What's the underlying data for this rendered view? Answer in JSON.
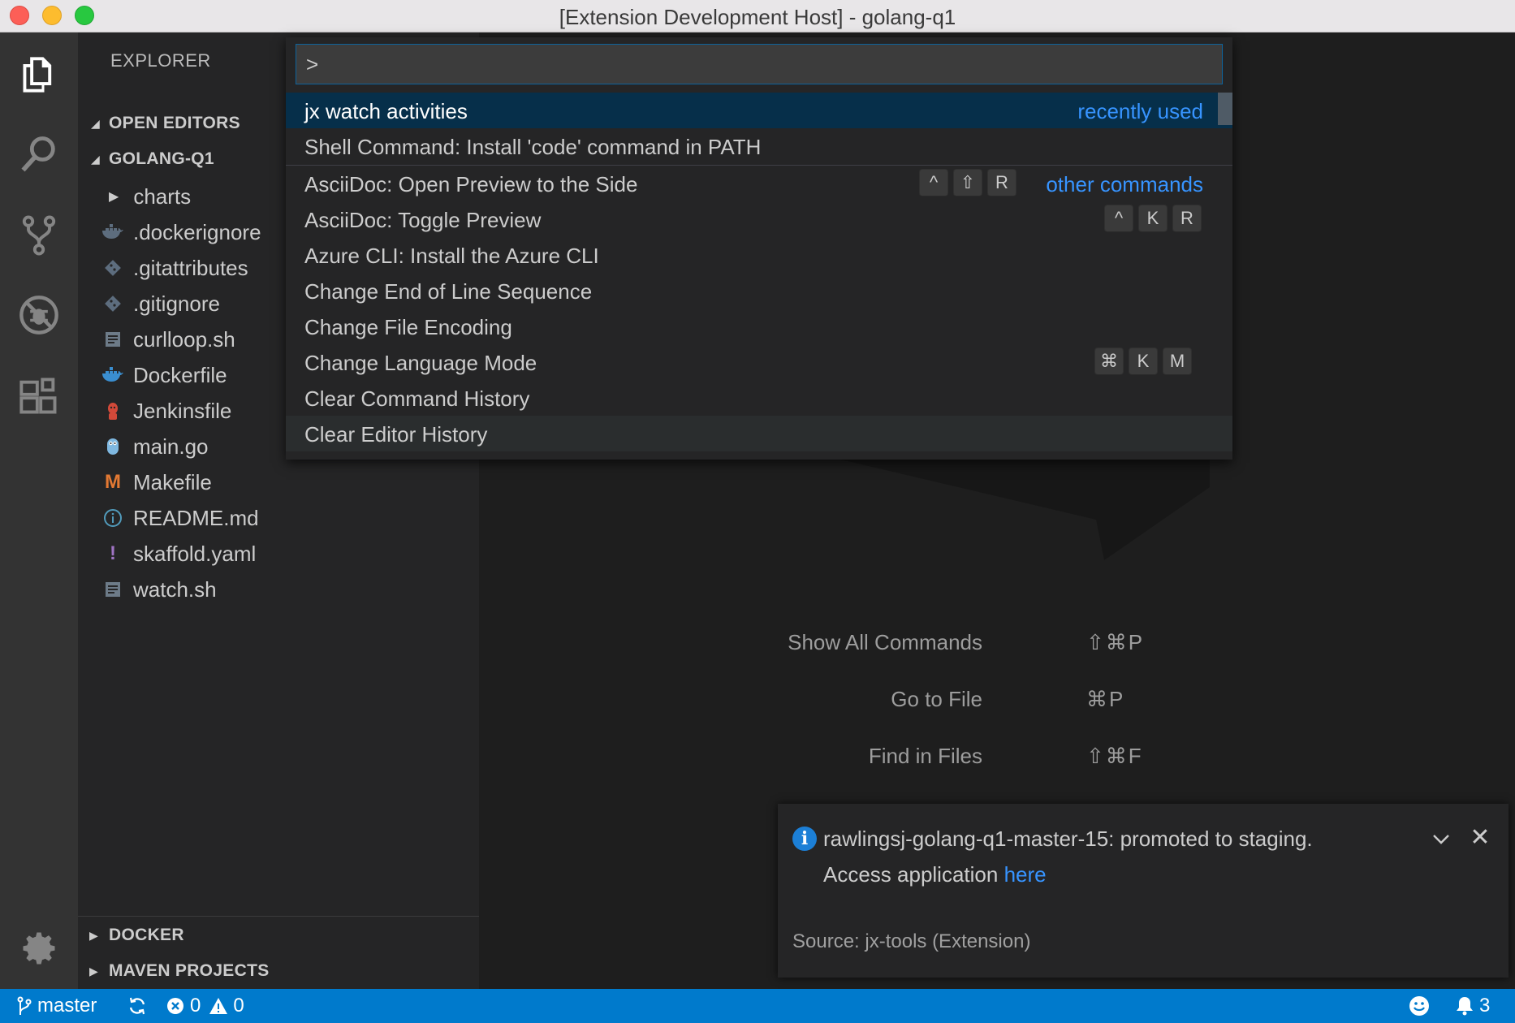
{
  "window": {
    "title": "[Extension Development Host] - golang-q1"
  },
  "activity_bar": {
    "items": [
      "explorer-icon",
      "search-icon",
      "source-control-icon",
      "debug-icon",
      "extensions-icon"
    ],
    "bottom": "gear-icon"
  },
  "sidebar": {
    "title": "EXPLORER",
    "open_editors": "OPEN EDITORS",
    "project": "GOLANG-Q1",
    "files": [
      {
        "name": "charts",
        "icon": "folder-chevron-icon",
        "color": "#cccccc"
      },
      {
        "name": ".dockerignore",
        "icon": "docker-icon",
        "color": "#5d6d7e"
      },
      {
        "name": ".gitattributes",
        "icon": "git-icon",
        "color": "#5d6d7e"
      },
      {
        "name": ".gitignore",
        "icon": "git-icon",
        "color": "#5d6d7e"
      },
      {
        "name": "curlloop.sh",
        "icon": "shell-file-icon",
        "color": "#6d7b88"
      },
      {
        "name": "Dockerfile",
        "icon": "docker-icon",
        "color": "#3a8ed0"
      },
      {
        "name": "Jenkinsfile",
        "icon": "jenkins-icon",
        "color": "#d24939"
      },
      {
        "name": "main.go",
        "icon": "go-gopher-icon",
        "color": "#7fb8e0"
      },
      {
        "name": "Makefile",
        "icon": "makefile-icon",
        "color": "#e37933"
      },
      {
        "name": "README.md",
        "icon": "info-icon",
        "color": "#519aba"
      },
      {
        "name": "skaffold.yaml",
        "icon": "yaml-icon",
        "color": "#a074c4"
      },
      {
        "name": "watch.sh",
        "icon": "shell-file-icon",
        "color": "#6d7b88"
      }
    ],
    "docker": "DOCKER",
    "maven": "MAVEN PROJECTS"
  },
  "quick_open": {
    "input_value": ">",
    "items": [
      {
        "label": "jx watch activities",
        "tag": "recently used",
        "keys": []
      },
      {
        "label": "Shell Command: Install 'code' command in PATH",
        "tag": "",
        "keys": []
      },
      {
        "label": "AsciiDoc: Open Preview to the Side",
        "tag": "other commands",
        "keys": [
          "^",
          "⇧",
          "R"
        ]
      },
      {
        "label": "AsciiDoc: Toggle Preview",
        "tag": "",
        "keys": [
          "^",
          "K",
          "R"
        ]
      },
      {
        "label": "Azure CLI: Install the Azure CLI",
        "tag": "",
        "keys": []
      },
      {
        "label": "Change End of Line Sequence",
        "tag": "",
        "keys": []
      },
      {
        "label": "Change File Encoding",
        "tag": "",
        "keys": []
      },
      {
        "label": "Change Language Mode",
        "tag": "",
        "keys": [
          "⌘",
          "K",
          "M"
        ]
      },
      {
        "label": "Clear Command History",
        "tag": "",
        "keys": []
      },
      {
        "label": "Clear Editor History",
        "tag": "",
        "keys": []
      }
    ]
  },
  "editor_shortcuts": [
    {
      "label": "Show All Commands",
      "keys": "⇧⌘P"
    },
    {
      "label": "Go to File",
      "keys": "⌘P"
    },
    {
      "label": "Find in Files",
      "keys": "⇧⌘F"
    }
  ],
  "notification": {
    "message": "rawlingsj-golang-q1-master-15: promoted to staging.",
    "line2_prefix": "Access application ",
    "link": "here",
    "source": "Source: jx-tools (Extension)"
  },
  "status_bar": {
    "branch": "master",
    "errors": "0",
    "warnings": "0",
    "notifications": "3"
  },
  "colors": {
    "accent": "#007acc",
    "selection": "#062f4a",
    "link": "#3794ff"
  }
}
